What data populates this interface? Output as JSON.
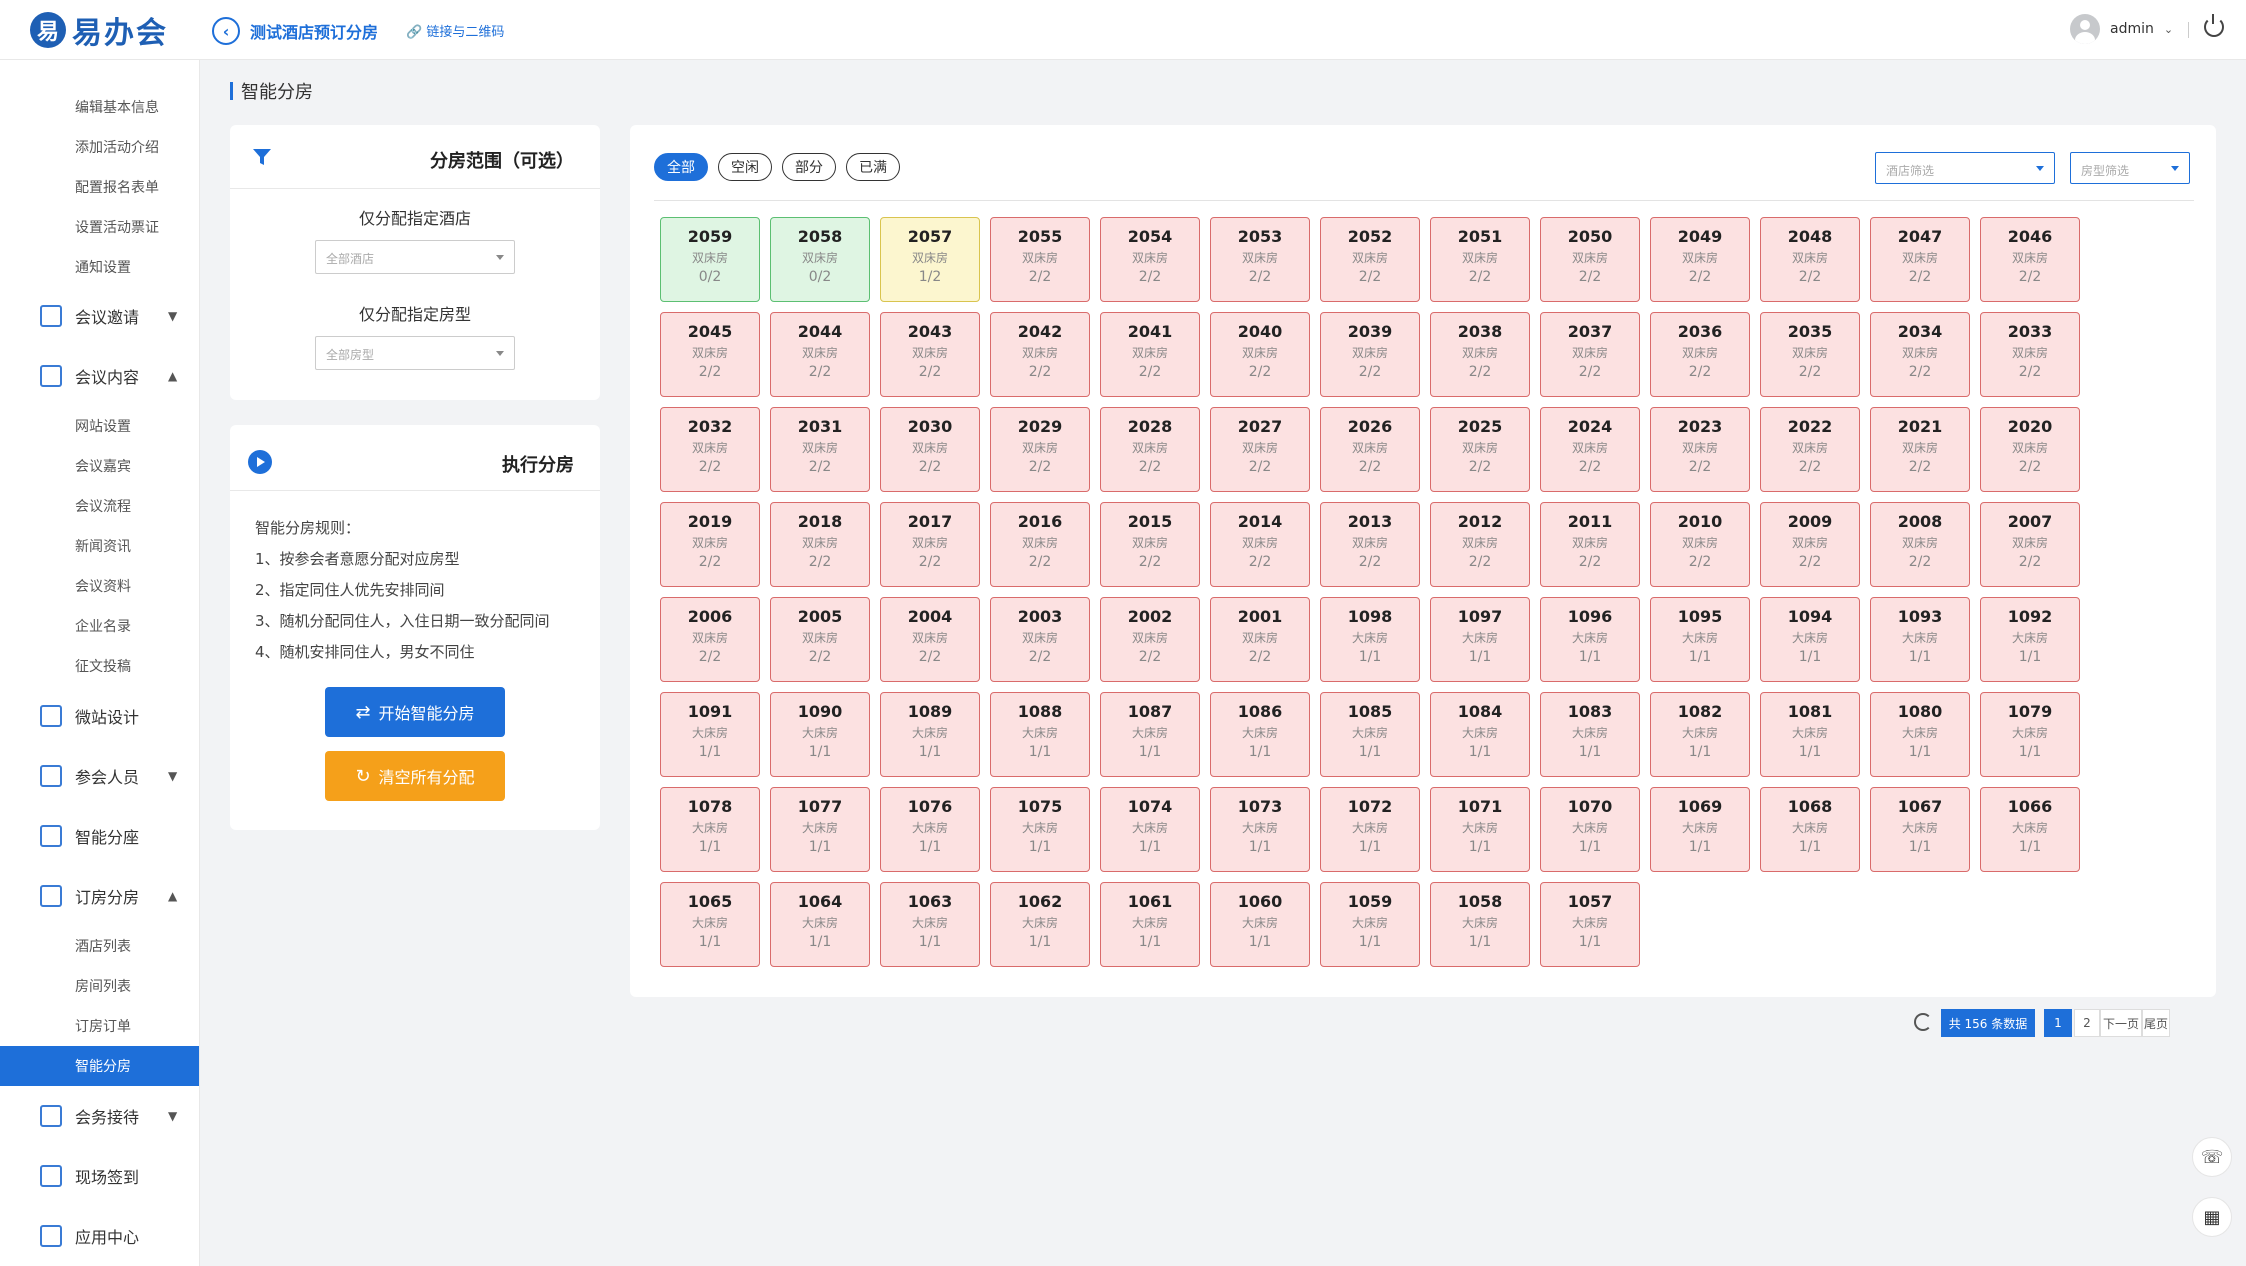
{
  "app": {
    "logo_mark": "易",
    "logo_text": "易办会"
  },
  "header": {
    "title": "测试酒店预订分房",
    "qr_link": "链接与二维码",
    "user": "admin"
  },
  "sidebar": {
    "groups": [
      {
        "label": "编辑基本信息"
      },
      {
        "label": "添加活动介绍"
      },
      {
        "label": "配置报名表单"
      },
      {
        "label": "设置活动票证"
      },
      {
        "label": "通知设置"
      },
      {
        "label": "会议邀请"
      },
      {
        "label": "会议内容"
      },
      {
        "label": "网站设置"
      },
      {
        "label": "会议嘉宾"
      },
      {
        "label": "会议流程"
      },
      {
        "label": "新闻资讯"
      },
      {
        "label": "会议资料"
      },
      {
        "label": "企业名录"
      },
      {
        "label": "征文投稿"
      },
      {
        "label": "微站设计"
      },
      {
        "label": "参会人员"
      },
      {
        "label": "智能分座"
      },
      {
        "label": "订房分房"
      },
      {
        "label": "酒店列表"
      },
      {
        "label": "房间列表"
      },
      {
        "label": "订房订单"
      },
      {
        "label": "智能分房"
      },
      {
        "label": "会务接待"
      },
      {
        "label": "现场签到"
      },
      {
        "label": "应用中心"
      }
    ]
  },
  "page": {
    "title": "智能分房"
  },
  "scope_panel": {
    "title": "分房范围（可选）",
    "hotel_label": "仅分配指定酒店",
    "hotel_placeholder": "全部酒店",
    "roomtype_label": "仅分配指定房型",
    "roomtype_placeholder": "全部房型"
  },
  "exec_panel": {
    "title": "执行分房",
    "rules_title": "智能分房规则：",
    "rules": [
      "1、按参会者意愿分配对应房型",
      "2、指定同住人优先安排同间",
      "3、随机分配同住人，入住日期一致分配同间",
      "4、随机安排同住人，男女不同住"
    ],
    "start_button": "开始智能分房",
    "clear_button": "清空所有分配"
  },
  "filters": {
    "tabs": [
      "全部",
      "空闲",
      "部分",
      "已满"
    ],
    "hotel_filter": "酒店筛选",
    "roomtype_filter": "房型筛选"
  },
  "rooms": [
    {
      "n": "2059",
      "t": "双床房",
      "o": "0/2",
      "s": "free"
    },
    {
      "n": "2058",
      "t": "双床房",
      "o": "0/2",
      "s": "free"
    },
    {
      "n": "2057",
      "t": "双床房",
      "o": "1/2",
      "s": "partial"
    },
    {
      "n": "2055",
      "t": "双床房",
      "o": "2/2",
      "s": "full"
    },
    {
      "n": "2054",
      "t": "双床房",
      "o": "2/2",
      "s": "full"
    },
    {
      "n": "2053",
      "t": "双床房",
      "o": "2/2",
      "s": "full"
    },
    {
      "n": "2052",
      "t": "双床房",
      "o": "2/2",
      "s": "full"
    },
    {
      "n": "2051",
      "t": "双床房",
      "o": "2/2",
      "s": "full"
    },
    {
      "n": "2050",
      "t": "双床房",
      "o": "2/2",
      "s": "full"
    },
    {
      "n": "2049",
      "t": "双床房",
      "o": "2/2",
      "s": "full"
    },
    {
      "n": "2048",
      "t": "双床房",
      "o": "2/2",
      "s": "full"
    },
    {
      "n": "2047",
      "t": "双床房",
      "o": "2/2",
      "s": "full"
    },
    {
      "n": "2046",
      "t": "双床房",
      "o": "2/2",
      "s": "full"
    },
    {
      "n": "2045",
      "t": "双床房",
      "o": "2/2",
      "s": "full"
    },
    {
      "n": "2044",
      "t": "双床房",
      "o": "2/2",
      "s": "full"
    },
    {
      "n": "2043",
      "t": "双床房",
      "o": "2/2",
      "s": "full"
    },
    {
      "n": "2042",
      "t": "双床房",
      "o": "2/2",
      "s": "full"
    },
    {
      "n": "2041",
      "t": "双床房",
      "o": "2/2",
      "s": "full"
    },
    {
      "n": "2040",
      "t": "双床房",
      "o": "2/2",
      "s": "full"
    },
    {
      "n": "2039",
      "t": "双床房",
      "o": "2/2",
      "s": "full"
    },
    {
      "n": "2038",
      "t": "双床房",
      "o": "2/2",
      "s": "full"
    },
    {
      "n": "2037",
      "t": "双床房",
      "o": "2/2",
      "s": "full"
    },
    {
      "n": "2036",
      "t": "双床房",
      "o": "2/2",
      "s": "full"
    },
    {
      "n": "2035",
      "t": "双床房",
      "o": "2/2",
      "s": "full"
    },
    {
      "n": "2034",
      "t": "双床房",
      "o": "2/2",
      "s": "full"
    },
    {
      "n": "2033",
      "t": "双床房",
      "o": "2/2",
      "s": "full"
    },
    {
      "n": "2032",
      "t": "双床房",
      "o": "2/2",
      "s": "full"
    },
    {
      "n": "2031",
      "t": "双床房",
      "o": "2/2",
      "s": "full"
    },
    {
      "n": "2030",
      "t": "双床房",
      "o": "2/2",
      "s": "full"
    },
    {
      "n": "2029",
      "t": "双床房",
      "o": "2/2",
      "s": "full"
    },
    {
      "n": "2028",
      "t": "双床房",
      "o": "2/2",
      "s": "full"
    },
    {
      "n": "2027",
      "t": "双床房",
      "o": "2/2",
      "s": "full"
    },
    {
      "n": "2026",
      "t": "双床房",
      "o": "2/2",
      "s": "full"
    },
    {
      "n": "2025",
      "t": "双床房",
      "o": "2/2",
      "s": "full"
    },
    {
      "n": "2024",
      "t": "双床房",
      "o": "2/2",
      "s": "full"
    },
    {
      "n": "2023",
      "t": "双床房",
      "o": "2/2",
      "s": "full"
    },
    {
      "n": "2022",
      "t": "双床房",
      "o": "2/2",
      "s": "full"
    },
    {
      "n": "2021",
      "t": "双床房",
      "o": "2/2",
      "s": "full"
    },
    {
      "n": "2020",
      "t": "双床房",
      "o": "2/2",
      "s": "full"
    },
    {
      "n": "2019",
      "t": "双床房",
      "o": "2/2",
      "s": "full"
    },
    {
      "n": "2018",
      "t": "双床房",
      "o": "2/2",
      "s": "full"
    },
    {
      "n": "2017",
      "t": "双床房",
      "o": "2/2",
      "s": "full"
    },
    {
      "n": "2016",
      "t": "双床房",
      "o": "2/2",
      "s": "full"
    },
    {
      "n": "2015",
      "t": "双床房",
      "o": "2/2",
      "s": "full"
    },
    {
      "n": "2014",
      "t": "双床房",
      "o": "2/2",
      "s": "full"
    },
    {
      "n": "2013",
      "t": "双床房",
      "o": "2/2",
      "s": "full"
    },
    {
      "n": "2012",
      "t": "双床房",
      "o": "2/2",
      "s": "full"
    },
    {
      "n": "2011",
      "t": "双床房",
      "o": "2/2",
      "s": "full"
    },
    {
      "n": "2010",
      "t": "双床房",
      "o": "2/2",
      "s": "full"
    },
    {
      "n": "2009",
      "t": "双床房",
      "o": "2/2",
      "s": "full"
    },
    {
      "n": "2008",
      "t": "双床房",
      "o": "2/2",
      "s": "full"
    },
    {
      "n": "2007",
      "t": "双床房",
      "o": "2/2",
      "s": "full"
    },
    {
      "n": "2006",
      "t": "双床房",
      "o": "2/2",
      "s": "full"
    },
    {
      "n": "2005",
      "t": "双床房",
      "o": "2/2",
      "s": "full"
    },
    {
      "n": "2004",
      "t": "双床房",
      "o": "2/2",
      "s": "full"
    },
    {
      "n": "2003",
      "t": "双床房",
      "o": "2/2",
      "s": "full"
    },
    {
      "n": "2002",
      "t": "双床房",
      "o": "2/2",
      "s": "full"
    },
    {
      "n": "2001",
      "t": "双床房",
      "o": "2/2",
      "s": "full"
    },
    {
      "n": "1098",
      "t": "大床房",
      "o": "1/1",
      "s": "full"
    },
    {
      "n": "1097",
      "t": "大床房",
      "o": "1/1",
      "s": "full"
    },
    {
      "n": "1096",
      "t": "大床房",
      "o": "1/1",
      "s": "full"
    },
    {
      "n": "1095",
      "t": "大床房",
      "o": "1/1",
      "s": "full"
    },
    {
      "n": "1094",
      "t": "大床房",
      "o": "1/1",
      "s": "full"
    },
    {
      "n": "1093",
      "t": "大床房",
      "o": "1/1",
      "s": "full"
    },
    {
      "n": "1092",
      "t": "大床房",
      "o": "1/1",
      "s": "full"
    },
    {
      "n": "1091",
      "t": "大床房",
      "o": "1/1",
      "s": "full"
    },
    {
      "n": "1090",
      "t": "大床房",
      "o": "1/1",
      "s": "full"
    },
    {
      "n": "1089",
      "t": "大床房",
      "o": "1/1",
      "s": "full"
    },
    {
      "n": "1088",
      "t": "大床房",
      "o": "1/1",
      "s": "full"
    },
    {
      "n": "1087",
      "t": "大床房",
      "o": "1/1",
      "s": "full"
    },
    {
      "n": "1086",
      "t": "大床房",
      "o": "1/1",
      "s": "full"
    },
    {
      "n": "1085",
      "t": "大床房",
      "o": "1/1",
      "s": "full"
    },
    {
      "n": "1084",
      "t": "大床房",
      "o": "1/1",
      "s": "full"
    },
    {
      "n": "1083",
      "t": "大床房",
      "o": "1/1",
      "s": "full"
    },
    {
      "n": "1082",
      "t": "大床房",
      "o": "1/1",
      "s": "full"
    },
    {
      "n": "1081",
      "t": "大床房",
      "o": "1/1",
      "s": "full"
    },
    {
      "n": "1080",
      "t": "大床房",
      "o": "1/1",
      "s": "full"
    },
    {
      "n": "1079",
      "t": "大床房",
      "o": "1/1",
      "s": "full"
    },
    {
      "n": "1078",
      "t": "大床房",
      "o": "1/1",
      "s": "full"
    },
    {
      "n": "1077",
      "t": "大床房",
      "o": "1/1",
      "s": "full"
    },
    {
      "n": "1076",
      "t": "大床房",
      "o": "1/1",
      "s": "full"
    },
    {
      "n": "1075",
      "t": "大床房",
      "o": "1/1",
      "s": "full"
    },
    {
      "n": "1074",
      "t": "大床房",
      "o": "1/1",
      "s": "full"
    },
    {
      "n": "1073",
      "t": "大床房",
      "o": "1/1",
      "s": "full"
    },
    {
      "n": "1072",
      "t": "大床房",
      "o": "1/1",
      "s": "full"
    },
    {
      "n": "1071",
      "t": "大床房",
      "o": "1/1",
      "s": "full"
    },
    {
      "n": "1070",
      "t": "大床房",
      "o": "1/1",
      "s": "full"
    },
    {
      "n": "1069",
      "t": "大床房",
      "o": "1/1",
      "s": "full"
    },
    {
      "n": "1068",
      "t": "大床房",
      "o": "1/1",
      "s": "full"
    },
    {
      "n": "1067",
      "t": "大床房",
      "o": "1/1",
      "s": "full"
    },
    {
      "n": "1066",
      "t": "大床房",
      "o": "1/1",
      "s": "full"
    },
    {
      "n": "1065",
      "t": "大床房",
      "o": "1/1",
      "s": "full"
    },
    {
      "n": "1064",
      "t": "大床房",
      "o": "1/1",
      "s": "full"
    },
    {
      "n": "1063",
      "t": "大床房",
      "o": "1/1",
      "s": "full"
    },
    {
      "n": "1062",
      "t": "大床房",
      "o": "1/1",
      "s": "full"
    },
    {
      "n": "1061",
      "t": "大床房",
      "o": "1/1",
      "s": "full"
    },
    {
      "n": "1060",
      "t": "大床房",
      "o": "1/1",
      "s": "full"
    },
    {
      "n": "1059",
      "t": "大床房",
      "o": "1/1",
      "s": "full"
    },
    {
      "n": "1058",
      "t": "大床房",
      "o": "1/1",
      "s": "full"
    },
    {
      "n": "1057",
      "t": "大床房",
      "o": "1/1",
      "s": "full"
    }
  ],
  "pagination": {
    "total": "共 156 条数据",
    "pages": [
      "1",
      "2"
    ],
    "next": "下一页",
    "last": "尾页",
    "current": "1"
  },
  "colors": {
    "accent": "#1e6fd9",
    "full_bg": "#fce1e1",
    "free_bg": "#dff5e3",
    "partial_bg": "#fcf6cf",
    "orange": "#f5a01a"
  }
}
